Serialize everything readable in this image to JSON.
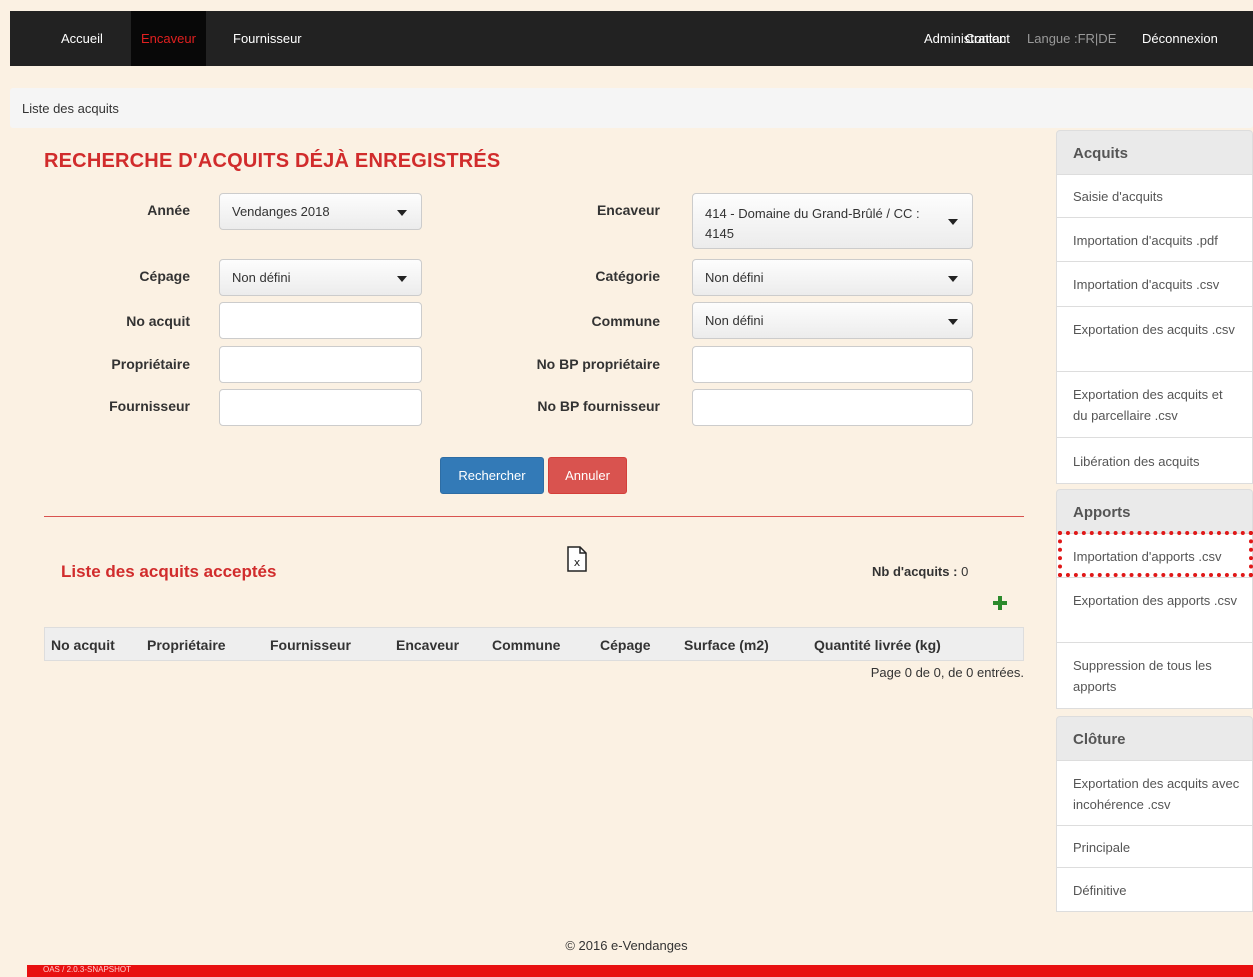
{
  "nav": {
    "accueil": "Accueil",
    "encaveur": "Encaveur",
    "fournisseur": "Fournisseur",
    "administration": "Administration",
    "contact": "Contact",
    "langue": "Langue :FR|DE",
    "deconnexion": "Déconnexion"
  },
  "breadcrumb": "Liste des acquits",
  "page_title": "RECHERCHE D'ACQUITS DÉJÀ ENREGISTRÉS",
  "form": {
    "annee_label": "Année",
    "annee_value": "Vendanges 2018",
    "cepage_label": "Cépage",
    "cepage_value": "Non défini",
    "no_acquit_label": "No acquit",
    "no_acquit_value": "",
    "proprietaire_label": "Propriétaire",
    "proprietaire_value": "",
    "fournisseur_label": "Fournisseur",
    "fournisseur_value": "",
    "encaveur_label": "Encaveur",
    "encaveur_value": "414 - Domaine du Grand-Brûlé / CC : 4145",
    "categorie_label": "Catégorie",
    "categorie_value": "Non défini",
    "commune_label": "Commune",
    "commune_value": "Non défini",
    "no_bp_proprietaire_label": "No BP propriétaire",
    "no_bp_proprietaire_value": "",
    "no_bp_fournisseur_label": "No BP fournisseur",
    "no_bp_fournisseur_value": "",
    "rechercher": "Rechercher",
    "annuler": "Annuler"
  },
  "list": {
    "title": "Liste des acquits acceptés",
    "nb_label": "Nb d'acquits :",
    "nb_value": "0",
    "columns": [
      "No acquit",
      "Propriétaire",
      "Fournisseur",
      "Encaveur",
      "Commune",
      "Cépage",
      "Surface (m2)",
      "Quantité livrée (kg)"
    ],
    "pager": "Page 0 de 0, de 0 entrées."
  },
  "sidebar": {
    "acquits_title": "Acquits",
    "acquits_items": [
      "Saisie d'acquits",
      "Importation d'acquits .pdf",
      "Importation d'acquits .csv",
      "Exportation des acquits .csv",
      "Exportation des acquits et du parcellaire .csv",
      "Libération des acquits"
    ],
    "apports_title": "Apports",
    "apports_items": [
      "Importation d'apports .csv",
      "Exportation des apports .csv",
      "Suppression de tous les apports"
    ],
    "cloture_title": "Clôture",
    "cloture_items": [
      "Exportation des acquits avec incohérence .csv",
      "Principale",
      "Définitive"
    ]
  },
  "footer": "© 2016 e-Vendanges",
  "version": "OAS / 2.0.3-SNAPSHOT",
  "colors": {
    "accent_red": "#d12c2c",
    "primary_blue": "#337ab7",
    "danger_red": "#d9534f",
    "navbar": "#222222",
    "background": "#fbf1e3"
  }
}
